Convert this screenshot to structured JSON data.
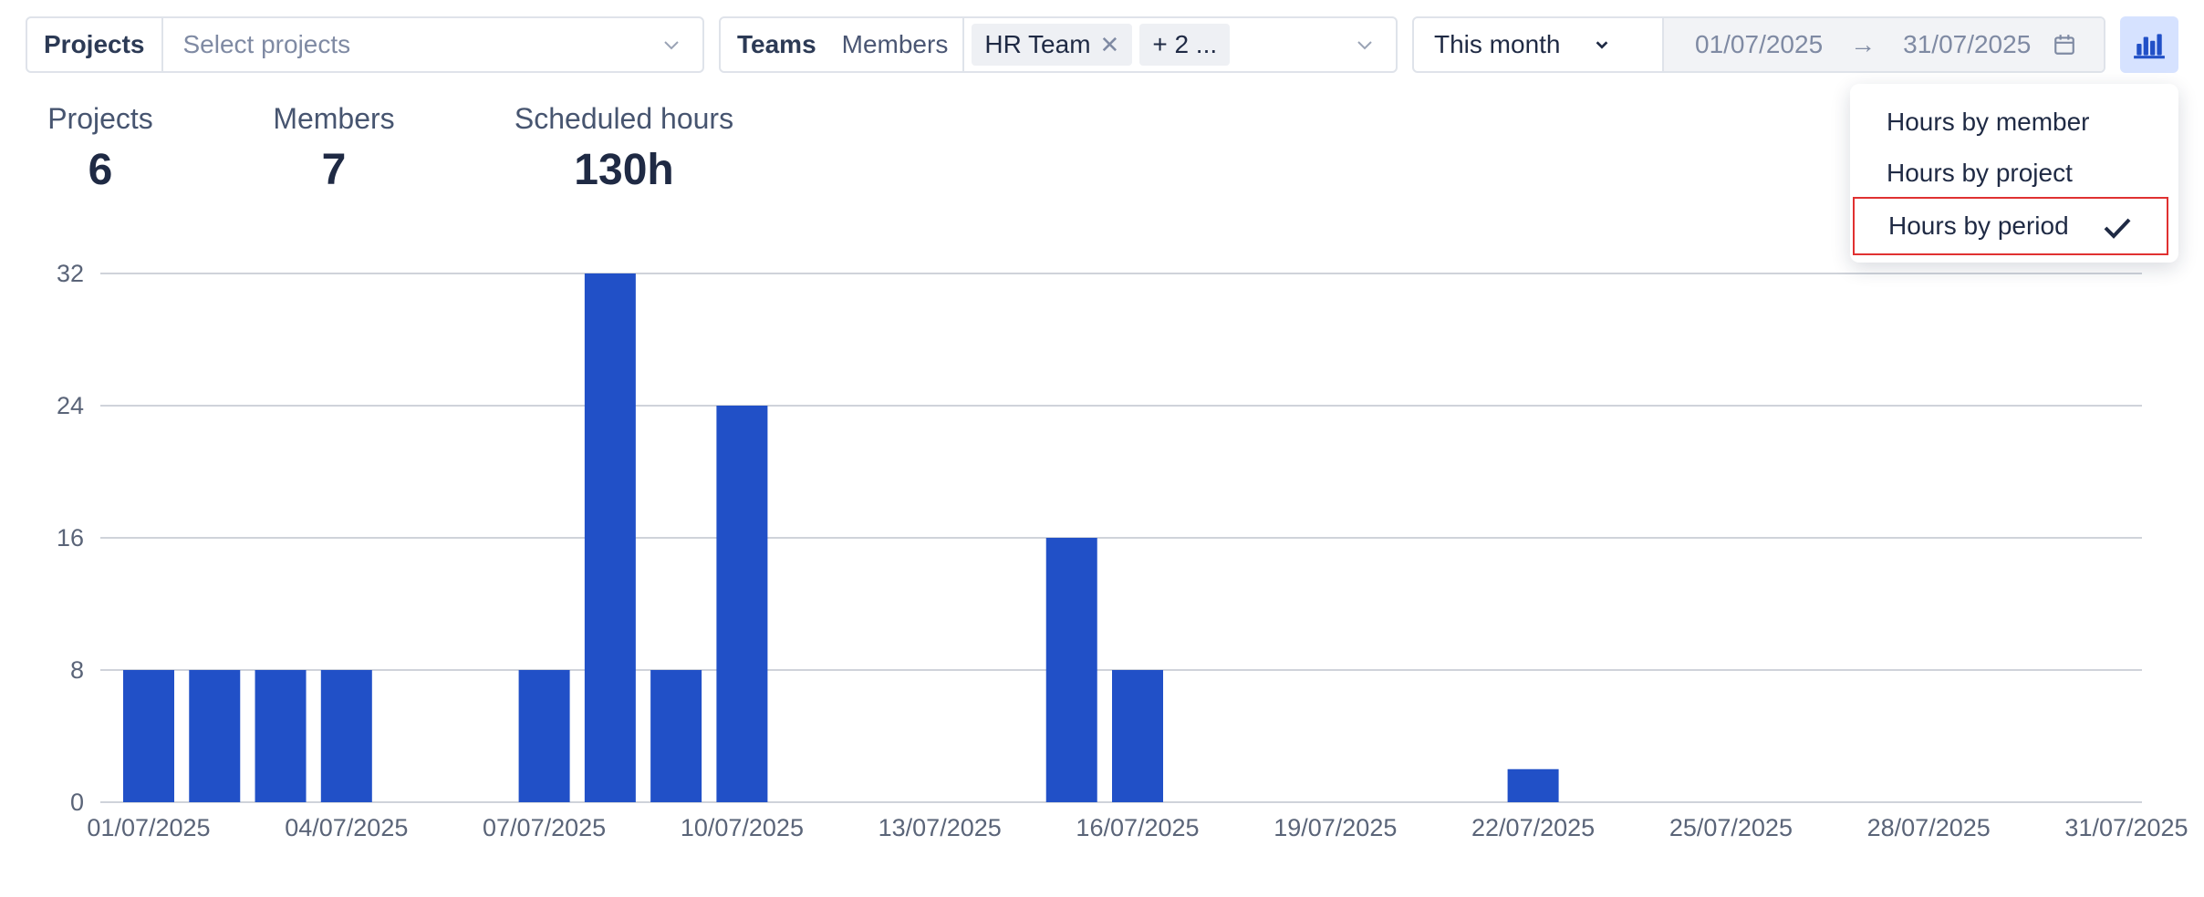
{
  "filters": {
    "projects": {
      "label": "Projects",
      "placeholder": "Select projects"
    },
    "teams": {
      "tab_active": "Teams",
      "tab_other": "Members",
      "chip": "HR Team",
      "chip_more": "+ 2 ..."
    },
    "period": {
      "label": "This month",
      "start": "01/07/2025",
      "end": "31/07/2025",
      "arrow": "→"
    }
  },
  "stats": [
    {
      "label": "Projects",
      "value": "6"
    },
    {
      "label": "Members",
      "value": "7"
    },
    {
      "label": "Scheduled hours",
      "value": "130h"
    }
  ],
  "menu": {
    "items": [
      "Hours by member",
      "Hours by project",
      "Hours by period"
    ],
    "selected_index": 2
  },
  "colors": {
    "bar": "#2150c7",
    "accent_bg": "#d6e2ff",
    "highlight_border": "#e03131"
  },
  "icons": {
    "chart_toggle": "bar-chart-icon",
    "calendar": "calendar-icon",
    "check": "check-icon",
    "chevron": "chevron-down-icon",
    "close": "close-icon"
  },
  "chart_data": {
    "type": "bar",
    "ylim": [
      0,
      32
    ],
    "yticks": [
      0,
      8,
      16,
      24,
      32
    ],
    "grid": true,
    "categories": [
      "01/07/2025",
      "02/07/2025",
      "03/07/2025",
      "04/07/2025",
      "05/07/2025",
      "06/07/2025",
      "07/07/2025",
      "08/07/2025",
      "09/07/2025",
      "10/07/2025",
      "11/07/2025",
      "12/07/2025",
      "13/07/2025",
      "14/07/2025",
      "15/07/2025",
      "16/07/2025",
      "17/07/2025",
      "18/07/2025",
      "19/07/2025",
      "20/07/2025",
      "21/07/2025",
      "22/07/2025",
      "23/07/2025",
      "24/07/2025",
      "25/07/2025",
      "26/07/2025",
      "27/07/2025",
      "28/07/2025",
      "29/07/2025",
      "30/07/2025",
      "31/07/2025"
    ],
    "values": [
      8,
      8,
      8,
      8,
      0,
      0,
      8,
      32,
      8,
      24,
      0,
      0,
      0,
      0,
      16,
      8,
      0,
      0,
      0,
      0,
      0,
      2,
      0,
      0,
      0,
      0,
      0,
      0,
      0,
      0,
      0
    ],
    "xtick_labels": [
      "01/07/2025",
      "04/07/2025",
      "07/07/2025",
      "10/07/2025",
      "13/07/2025",
      "16/07/2025",
      "19/07/2025",
      "22/07/2025",
      "25/07/2025",
      "28/07/2025",
      "31/07/2025"
    ]
  }
}
